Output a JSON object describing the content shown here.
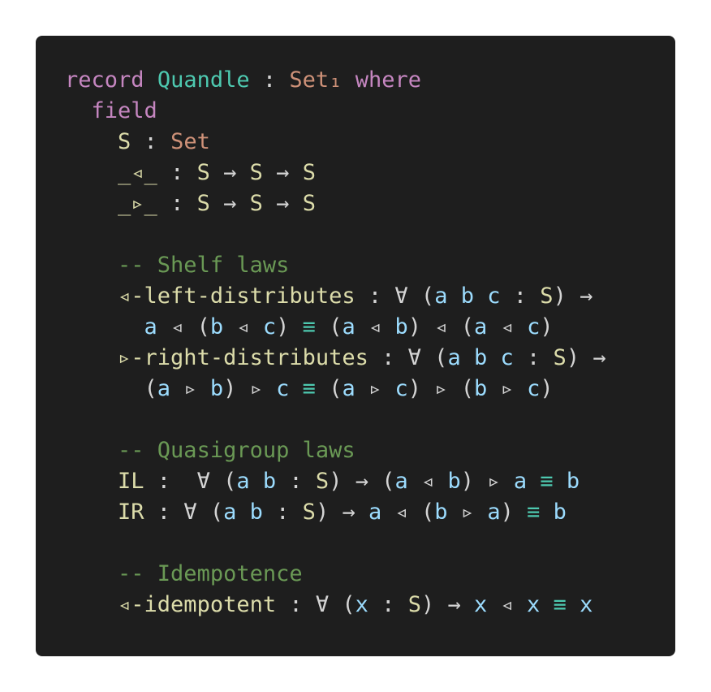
{
  "code_block": {
    "language": "agda",
    "lines": [
      [
        {
          "t": "kw",
          "v": "record"
        },
        {
          "t": "pl",
          "v": " "
        },
        {
          "t": "ty",
          "v": "Quandle"
        },
        {
          "t": "pl",
          "v": " : "
        },
        {
          "t": "st",
          "v": "Set₁"
        },
        {
          "t": "pl",
          "v": " "
        },
        {
          "t": "kw",
          "v": "where"
        }
      ],
      [
        {
          "t": "pl",
          "v": "  "
        },
        {
          "t": "kw",
          "v": "field"
        }
      ],
      [
        {
          "t": "pl",
          "v": "    "
        },
        {
          "t": "id",
          "v": "S"
        },
        {
          "t": "pl",
          "v": " : "
        },
        {
          "t": "st",
          "v": "Set"
        }
      ],
      [
        {
          "t": "pl",
          "v": "    "
        },
        {
          "t": "id",
          "v": "_◃_"
        },
        {
          "t": "pl",
          "v": " : "
        },
        {
          "t": "id",
          "v": "S"
        },
        {
          "t": "pl",
          "v": " → "
        },
        {
          "t": "id",
          "v": "S"
        },
        {
          "t": "pl",
          "v": " → "
        },
        {
          "t": "id",
          "v": "S"
        }
      ],
      [
        {
          "t": "pl",
          "v": "    "
        },
        {
          "t": "id",
          "v": "_▹_"
        },
        {
          "t": "pl",
          "v": " : "
        },
        {
          "t": "id",
          "v": "S"
        },
        {
          "t": "pl",
          "v": " → "
        },
        {
          "t": "id",
          "v": "S"
        },
        {
          "t": "pl",
          "v": " → "
        },
        {
          "t": "id",
          "v": "S"
        }
      ],
      [],
      [
        {
          "t": "pl",
          "v": "    "
        },
        {
          "t": "cm",
          "v": "-- Shelf laws"
        }
      ],
      [
        {
          "t": "pl",
          "v": "    "
        },
        {
          "t": "id",
          "v": "◃-left-distributes"
        },
        {
          "t": "pl",
          "v": " : ∀ ("
        },
        {
          "t": "vr",
          "v": "a"
        },
        {
          "t": "pl",
          "v": " "
        },
        {
          "t": "vr",
          "v": "b"
        },
        {
          "t": "pl",
          "v": " "
        },
        {
          "t": "vr",
          "v": "c"
        },
        {
          "t": "pl",
          "v": " : "
        },
        {
          "t": "id",
          "v": "S"
        },
        {
          "t": "pl",
          "v": ") →"
        }
      ],
      [
        {
          "t": "pl",
          "v": "      "
        },
        {
          "t": "vr",
          "v": "a"
        },
        {
          "t": "pl",
          "v": " ◃ ("
        },
        {
          "t": "vr",
          "v": "b"
        },
        {
          "t": "pl",
          "v": " ◃ "
        },
        {
          "t": "vr",
          "v": "c"
        },
        {
          "t": "pl",
          "v": ") "
        },
        {
          "t": "eq",
          "v": "≡"
        },
        {
          "t": "pl",
          "v": " ("
        },
        {
          "t": "vr",
          "v": "a"
        },
        {
          "t": "pl",
          "v": " ◃ "
        },
        {
          "t": "vr",
          "v": "b"
        },
        {
          "t": "pl",
          "v": ") ◃ ("
        },
        {
          "t": "vr",
          "v": "a"
        },
        {
          "t": "pl",
          "v": " ◃ "
        },
        {
          "t": "vr",
          "v": "c"
        },
        {
          "t": "pl",
          "v": ")"
        }
      ],
      [
        {
          "t": "pl",
          "v": "    "
        },
        {
          "t": "id",
          "v": "▹-right-distributes"
        },
        {
          "t": "pl",
          "v": " : ∀ ("
        },
        {
          "t": "vr",
          "v": "a"
        },
        {
          "t": "pl",
          "v": " "
        },
        {
          "t": "vr",
          "v": "b"
        },
        {
          "t": "pl",
          "v": " "
        },
        {
          "t": "vr",
          "v": "c"
        },
        {
          "t": "pl",
          "v": " : "
        },
        {
          "t": "id",
          "v": "S"
        },
        {
          "t": "pl",
          "v": ") →"
        }
      ],
      [
        {
          "t": "pl",
          "v": "      ("
        },
        {
          "t": "vr",
          "v": "a"
        },
        {
          "t": "pl",
          "v": " ▹ "
        },
        {
          "t": "vr",
          "v": "b"
        },
        {
          "t": "pl",
          "v": ") ▹ "
        },
        {
          "t": "vr",
          "v": "c"
        },
        {
          "t": "pl",
          "v": " "
        },
        {
          "t": "eq",
          "v": "≡"
        },
        {
          "t": "pl",
          "v": " ("
        },
        {
          "t": "vr",
          "v": "a"
        },
        {
          "t": "pl",
          "v": " ▹ "
        },
        {
          "t": "vr",
          "v": "c"
        },
        {
          "t": "pl",
          "v": ") ▹ ("
        },
        {
          "t": "vr",
          "v": "b"
        },
        {
          "t": "pl",
          "v": " ▹ "
        },
        {
          "t": "vr",
          "v": "c"
        },
        {
          "t": "pl",
          "v": ")"
        }
      ],
      [],
      [
        {
          "t": "pl",
          "v": "    "
        },
        {
          "t": "cm",
          "v": "-- Quasigroup laws"
        }
      ],
      [
        {
          "t": "pl",
          "v": "    "
        },
        {
          "t": "id",
          "v": "IL"
        },
        {
          "t": "pl",
          "v": " :  ∀ ("
        },
        {
          "t": "vr",
          "v": "a"
        },
        {
          "t": "pl",
          "v": " "
        },
        {
          "t": "vr",
          "v": "b"
        },
        {
          "t": "pl",
          "v": " : "
        },
        {
          "t": "id",
          "v": "S"
        },
        {
          "t": "pl",
          "v": ") → ("
        },
        {
          "t": "vr",
          "v": "a"
        },
        {
          "t": "pl",
          "v": " ◃ "
        },
        {
          "t": "vr",
          "v": "b"
        },
        {
          "t": "pl",
          "v": ") ▹ "
        },
        {
          "t": "vr",
          "v": "a"
        },
        {
          "t": "pl",
          "v": " "
        },
        {
          "t": "eq",
          "v": "≡"
        },
        {
          "t": "pl",
          "v": " "
        },
        {
          "t": "vr",
          "v": "b"
        }
      ],
      [
        {
          "t": "pl",
          "v": "    "
        },
        {
          "t": "id",
          "v": "IR"
        },
        {
          "t": "pl",
          "v": " : ∀ ("
        },
        {
          "t": "vr",
          "v": "a"
        },
        {
          "t": "pl",
          "v": " "
        },
        {
          "t": "vr",
          "v": "b"
        },
        {
          "t": "pl",
          "v": " : "
        },
        {
          "t": "id",
          "v": "S"
        },
        {
          "t": "pl",
          "v": ") → "
        },
        {
          "t": "vr",
          "v": "a"
        },
        {
          "t": "pl",
          "v": " ◃ ("
        },
        {
          "t": "vr",
          "v": "b"
        },
        {
          "t": "pl",
          "v": " ▹ "
        },
        {
          "t": "vr",
          "v": "a"
        },
        {
          "t": "pl",
          "v": ") "
        },
        {
          "t": "eq",
          "v": "≡"
        },
        {
          "t": "pl",
          "v": " "
        },
        {
          "t": "vr",
          "v": "b"
        }
      ],
      [],
      [
        {
          "t": "pl",
          "v": "    "
        },
        {
          "t": "cm",
          "v": "-- Idempotence"
        }
      ],
      [
        {
          "t": "pl",
          "v": "    "
        },
        {
          "t": "id",
          "v": "◃-idempotent"
        },
        {
          "t": "pl",
          "v": " : ∀ ("
        },
        {
          "t": "vr",
          "v": "x"
        },
        {
          "t": "pl",
          "v": " : "
        },
        {
          "t": "id",
          "v": "S"
        },
        {
          "t": "pl",
          "v": ") → "
        },
        {
          "t": "vr",
          "v": "x"
        },
        {
          "t": "pl",
          "v": " ◃ "
        },
        {
          "t": "vr",
          "v": "x"
        },
        {
          "t": "pl",
          "v": " "
        },
        {
          "t": "eq",
          "v": "≡"
        },
        {
          "t": "pl",
          "v": " "
        },
        {
          "t": "vr",
          "v": "x"
        }
      ]
    ]
  }
}
